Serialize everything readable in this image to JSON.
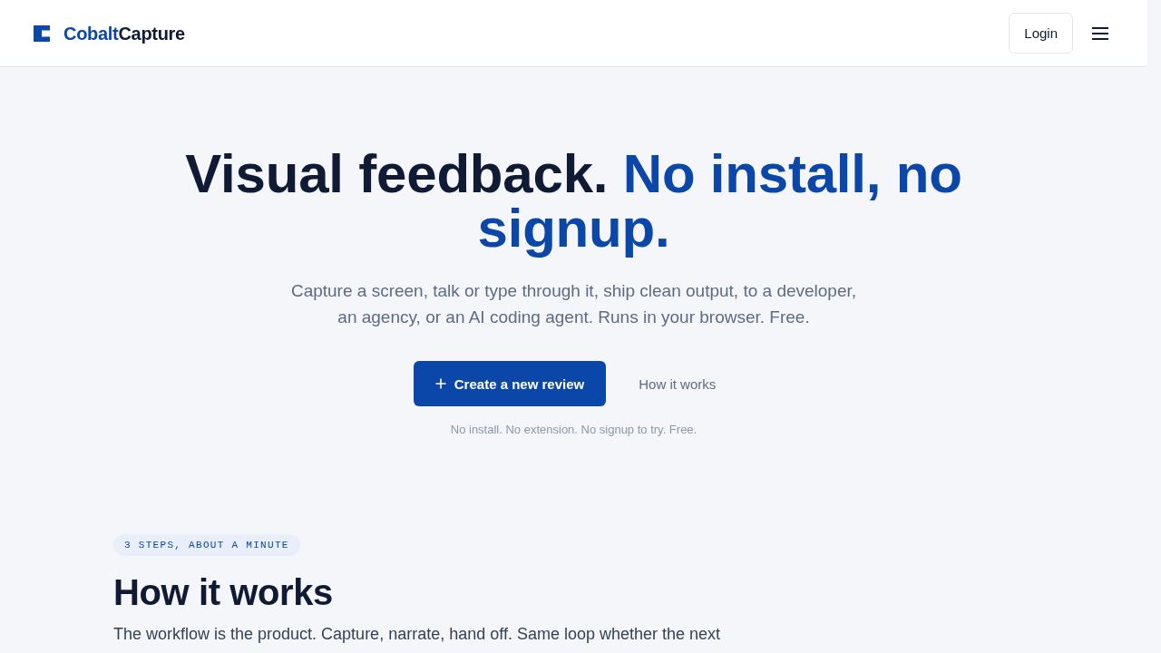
{
  "header": {
    "logo": {
      "first": "Cobalt",
      "second": "Capture"
    },
    "login": "Login"
  },
  "hero": {
    "title_lead": "Visual feedback.",
    "title_accent": "No install, no signup.",
    "subtitle": "Capture a screen, talk or type through it, ship clean output, to a developer, an agency, or an AI coding agent. Runs in your browser. Free.",
    "actions": [
      {
        "kind": "primary",
        "label": "Create a new review"
      },
      {
        "kind": "ghost",
        "label": "How it works"
      }
    ],
    "note": "No install. No extension. No signup to try. Free."
  },
  "how_it_works": {
    "badge": "3 STEPS, ABOUT A MINUTE",
    "heading": "How it works",
    "intro": "The workflow is the product. Capture, narrate, hand off. Same loop whether the next"
  }
}
